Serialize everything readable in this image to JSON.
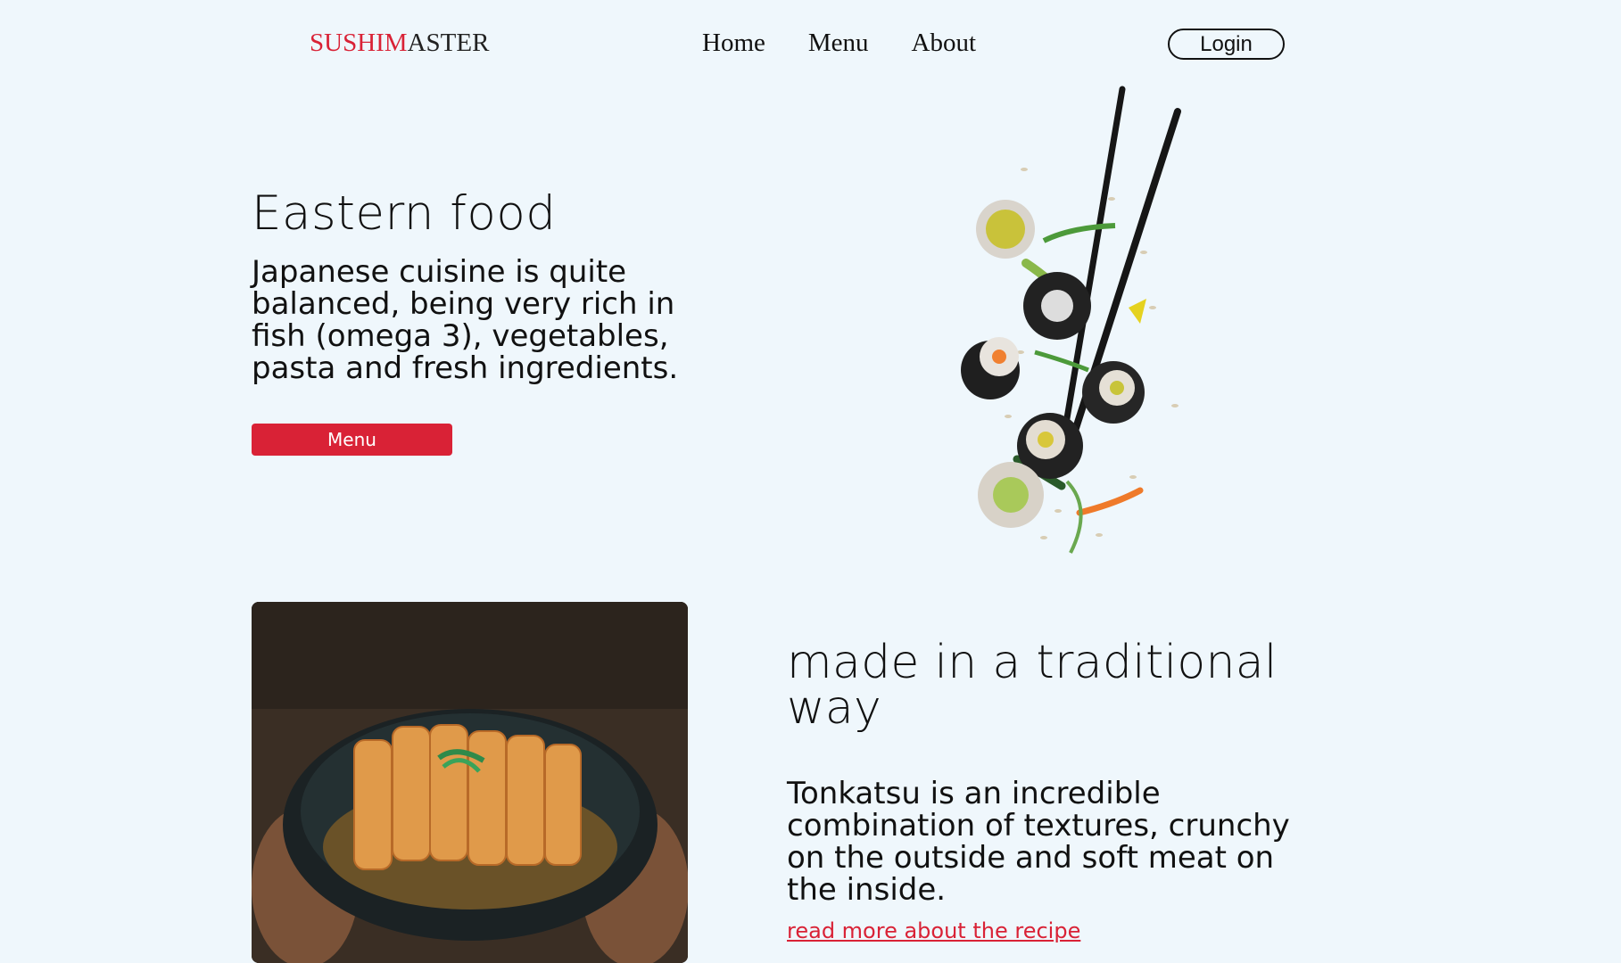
{
  "header": {
    "logo_accent": "SUSHIM",
    "logo_rest": "ASTER",
    "nav": [
      "Home",
      "Menu",
      "About"
    ],
    "login_label": "Login"
  },
  "hero": {
    "title": "Eastern food",
    "text": "Japanese cuisine is quite balanced, being very rich in fish (omega 3), vegetables, pasta and fresh ingredients.",
    "button_label": "Menu"
  },
  "section": {
    "title": "made in a traditional way",
    "text": "Tonkatsu is an incredible combination of textures, crunchy on the outside and soft meat on the inside.",
    "link_label": "read more about the recipe"
  },
  "colors": {
    "accent": "#d92236",
    "background": "#eff7fc"
  }
}
